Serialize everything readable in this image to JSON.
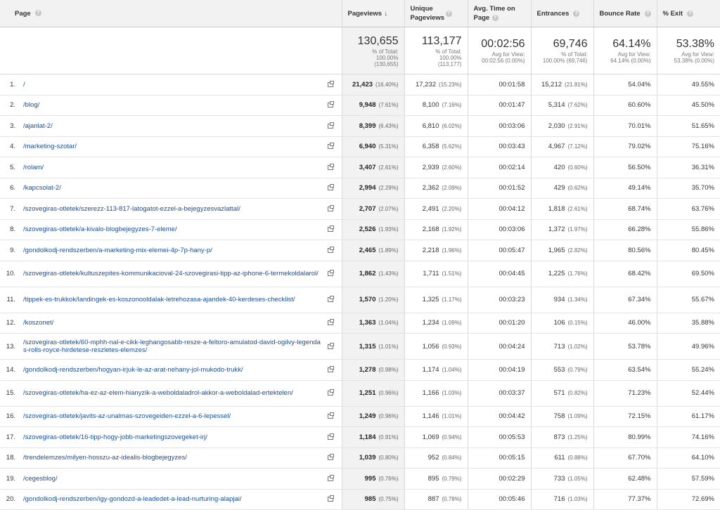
{
  "headers": {
    "page": "Page",
    "pageviews": "Pageviews",
    "unique_pageviews": "Unique Pageviews",
    "avg_time": "Avg. Time on Page",
    "entrances": "Entrances",
    "bounce_rate": "Bounce Rate",
    "exit": "% Exit",
    "help_glyph": "?",
    "sort_glyph": "↓"
  },
  "totals": {
    "pageviews": {
      "value": "130,655",
      "sub1": "% of Total:",
      "sub2": "100.00%",
      "sub3": "(130,655)"
    },
    "unique_pageviews": {
      "value": "113,177",
      "sub1": "% of Total:",
      "sub2": "100.00%",
      "sub3": "(113,177)"
    },
    "avg_time": {
      "value": "00:02:56",
      "sub1": "Avg for View:",
      "sub2": "00:02:56 (0.00%)"
    },
    "entrances": {
      "value": "69,746",
      "sub1": "% of Total:",
      "sub2": "100.00% (69,746)"
    },
    "bounce_rate": {
      "value": "64.14%",
      "sub1": "Avg for View:",
      "sub2": "64.14% (0.00%)"
    },
    "exit": {
      "value": "53.38%",
      "sub1": "Avg for View:",
      "sub2": "53.38% (0.00%)"
    }
  },
  "rows": [
    {
      "n": "1.",
      "page": "/",
      "pv": "21,423",
      "pv_pct": "(16.40%)",
      "upv": "17,232",
      "upv_pct": "(15.23%)",
      "atp": "00:01:58",
      "ent": "15,212",
      "ent_pct": "(21.81%)",
      "br": "54.04%",
      "ex": "49.55%"
    },
    {
      "n": "2.",
      "page": "/blog/",
      "pv": "9,948",
      "pv_pct": "(7.61%)",
      "upv": "8,100",
      "upv_pct": "(7.16%)",
      "atp": "00:01:47",
      "ent": "5,314",
      "ent_pct": "(7.62%)",
      "br": "60.60%",
      "ex": "45.50%"
    },
    {
      "n": "3.",
      "page": "/ajanlat-2/",
      "pv": "8,399",
      "pv_pct": "(6.43%)",
      "upv": "6,810",
      "upv_pct": "(6.02%)",
      "atp": "00:03:06",
      "ent": "2,030",
      "ent_pct": "(2.91%)",
      "br": "70.01%",
      "ex": "51.65%"
    },
    {
      "n": "4.",
      "page": "/marketing-szotar/",
      "pv": "6,940",
      "pv_pct": "(5.31%)",
      "upv": "6,358",
      "upv_pct": "(5.62%)",
      "atp": "00:03:43",
      "ent": "4,967",
      "ent_pct": "(7.12%)",
      "br": "79.02%",
      "ex": "75.16%"
    },
    {
      "n": "5.",
      "page": "/rolam/",
      "pv": "3,407",
      "pv_pct": "(2.61%)",
      "upv": "2,939",
      "upv_pct": "(2.60%)",
      "atp": "00:02:14",
      "ent": "420",
      "ent_pct": "(0.60%)",
      "br": "56.50%",
      "ex": "36.31%"
    },
    {
      "n": "6.",
      "page": "/kapcsolat-2/",
      "pv": "2,994",
      "pv_pct": "(2.29%)",
      "upv": "2,362",
      "upv_pct": "(2.09%)",
      "atp": "00:01:52",
      "ent": "429",
      "ent_pct": "(0.62%)",
      "br": "49.14%",
      "ex": "35.70%"
    },
    {
      "n": "7.",
      "page": "/szovegiras-otletek/szerezz-113-817-latogatot-ezzel-a-bejegyzesvazlattal/",
      "pv": "2,707",
      "pv_pct": "(2.07%)",
      "upv": "2,491",
      "upv_pct": "(2.20%)",
      "atp": "00:04:12",
      "ent": "1,818",
      "ent_pct": "(2.61%)",
      "br": "68.74%",
      "ex": "63.76%"
    },
    {
      "n": "8.",
      "page": "/szovegiras-otletek/a-kivalo-blogbejegyzes-7-eleme/",
      "pv": "2,526",
      "pv_pct": "(1.93%)",
      "upv": "2,168",
      "upv_pct": "(1.92%)",
      "atp": "00:03:06",
      "ent": "1,372",
      "ent_pct": "(1.97%)",
      "br": "66.28%",
      "ex": "55.86%"
    },
    {
      "n": "9.",
      "page": "/gondolkodj-rendszerben/a-marketing-mix-elemei-4p-7p-hany-p/",
      "pv": "2,465",
      "pv_pct": "(1.89%)",
      "upv": "2,218",
      "upv_pct": "(1.96%)",
      "atp": "00:05:47",
      "ent": "1,965",
      "ent_pct": "(2.82%)",
      "br": "80.56%",
      "ex": "80.45%"
    },
    {
      "n": "10.",
      "page": "/szovegiras-otletek/kultuszepites-kommunikacioval-24-szovegirasi-tipp-az-iphone-6-termekoldalarol/",
      "pv": "1,862",
      "pv_pct": "(1.43%)",
      "upv": "1,711",
      "upv_pct": "(1.51%)",
      "atp": "00:04:45",
      "ent": "1,225",
      "ent_pct": "(1.76%)",
      "br": "68.42%",
      "ex": "69.50%"
    },
    {
      "n": "11.",
      "page": "/tippek-es-trukkok/landingek-es-koszonooldalak-letrehozasa-ajandek-40-kerdeses-checklist/",
      "pv": "1,570",
      "pv_pct": "(1.20%)",
      "upv": "1,325",
      "upv_pct": "(1.17%)",
      "atp": "00:03:23",
      "ent": "934",
      "ent_pct": "(1.34%)",
      "br": "67.34%",
      "ex": "55.67%"
    },
    {
      "n": "12.",
      "page": "/koszonet/",
      "pv": "1,363",
      "pv_pct": "(1.04%)",
      "upv": "1,234",
      "upv_pct": "(1.09%)",
      "atp": "00:01:20",
      "ent": "106",
      "ent_pct": "(0.15%)",
      "br": "46.00%",
      "ex": "35.88%"
    },
    {
      "n": "13.",
      "page": "/szovegiras-otletek/60-mphh-nal-e-cikk-leghangosabb-resze-a-feltoro-amulatod-david-ogilvy-legendas-rolls-royce-hirdetese-reszletes-elemzes/",
      "pv": "1,315",
      "pv_pct": "(1.01%)",
      "upv": "1,056",
      "upv_pct": "(0.93%)",
      "atp": "00:04:24",
      "ent": "713",
      "ent_pct": "(1.02%)",
      "br": "53.78%",
      "ex": "49.96%"
    },
    {
      "n": "14.",
      "page": "/gondolkodj-rendszerben/hogyan-irjuk-le-az-arat-nehany-jol-mukodo-trukk/",
      "pv": "1,278",
      "pv_pct": "(0.98%)",
      "upv": "1,174",
      "upv_pct": "(1.04%)",
      "atp": "00:04:19",
      "ent": "553",
      "ent_pct": "(0.79%)",
      "br": "63.54%",
      "ex": "55.24%"
    },
    {
      "n": "15.",
      "page": "/szovegiras-otletek/ha-ez-az-elem-hianyzik-a-weboldaladrol-akkor-a-weboldalad-ertektelen/",
      "pv": "1,251",
      "pv_pct": "(0.96%)",
      "upv": "1,166",
      "upv_pct": "(1.03%)",
      "atp": "00:03:37",
      "ent": "571",
      "ent_pct": "(0.82%)",
      "br": "71.23%",
      "ex": "52.44%"
    },
    {
      "n": "16.",
      "page": "/szovegiras-otletek/javits-az-unalmas-szovegeiden-ezzel-a-6-lepessel/",
      "pv": "1,249",
      "pv_pct": "(0.96%)",
      "upv": "1,146",
      "upv_pct": "(1.01%)",
      "atp": "00:04:42",
      "ent": "758",
      "ent_pct": "(1.09%)",
      "br": "72.15%",
      "ex": "61.17%"
    },
    {
      "n": "17.",
      "page": "/szovegiras-otletek/16-tipp-hogy-jobb-marketingszovegeket-irj/",
      "pv": "1,184",
      "pv_pct": "(0.91%)",
      "upv": "1,069",
      "upv_pct": "(0.94%)",
      "atp": "00:05:53",
      "ent": "873",
      "ent_pct": "(1.25%)",
      "br": "80.99%",
      "ex": "74.16%"
    },
    {
      "n": "18.",
      "page": "/trendelemzes/milyen-hosszu-az-idealis-blogbejegyzes/",
      "pv": "1,039",
      "pv_pct": "(0.80%)",
      "upv": "952",
      "upv_pct": "(0.84%)",
      "atp": "00:05:15",
      "ent": "611",
      "ent_pct": "(0.88%)",
      "br": "67.70%",
      "ex": "64.10%"
    },
    {
      "n": "19.",
      "page": "/cegesblog/",
      "pv": "995",
      "pv_pct": "(0.76%)",
      "upv": "895",
      "upv_pct": "(0.79%)",
      "atp": "00:02:29",
      "ent": "733",
      "ent_pct": "(1.05%)",
      "br": "62.48%",
      "ex": "57.59%"
    },
    {
      "n": "20.",
      "page": "/gondolkodj-rendszerben/igy-gondozd-a-leadedet-a-lead-nurturing-alapjai/",
      "pv": "985",
      "pv_pct": "(0.75%)",
      "upv": "887",
      "upv_pct": "(0.78%)",
      "atp": "00:05:46",
      "ent": "716",
      "ent_pct": "(1.03%)",
      "br": "77.37%",
      "ex": "72.69%"
    }
  ]
}
